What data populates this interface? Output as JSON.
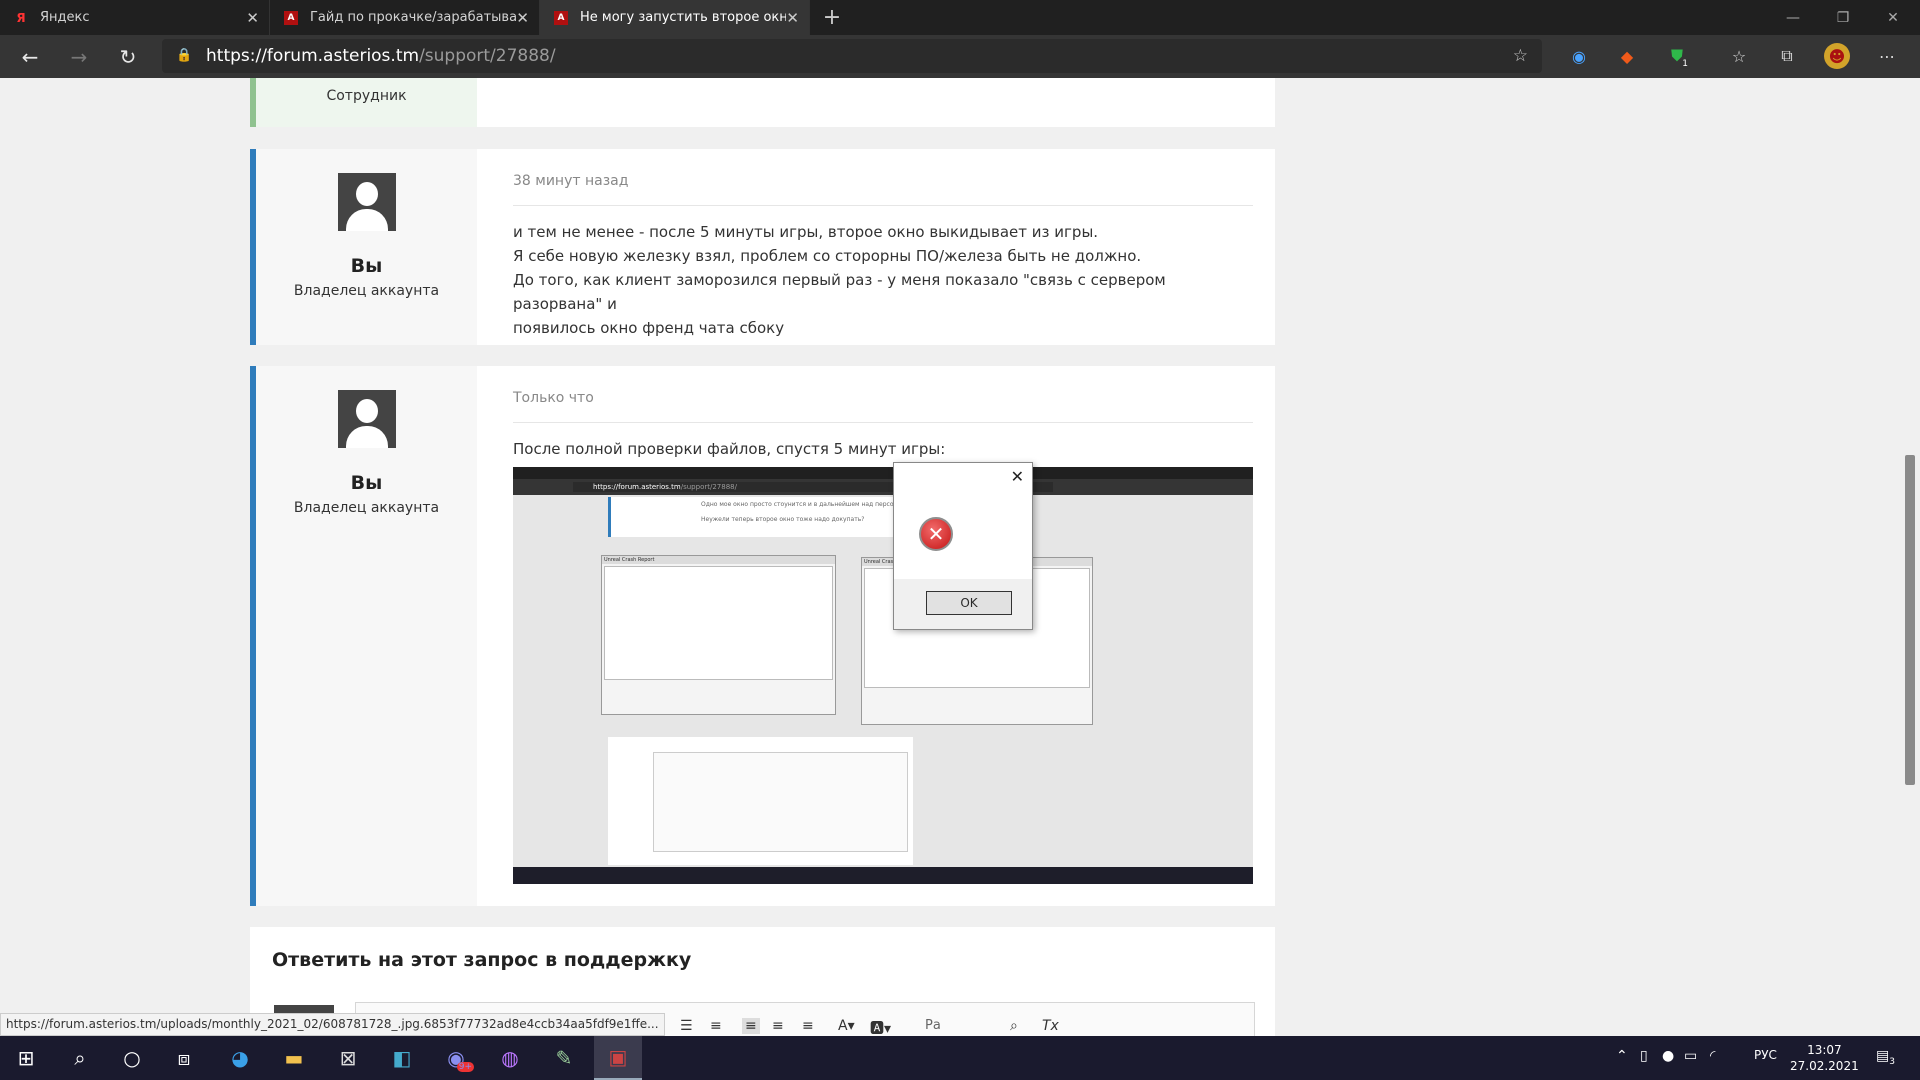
{
  "browser": {
    "tabs": [
      {
        "title": "Яндекс",
        "favicon": "Я"
      },
      {
        "title": "Гайд по прокачке/зарабатыван",
        "favicon": "A"
      },
      {
        "title": "Не могу запустить второе окно",
        "favicon": "A"
      }
    ],
    "url_host": "https://forum.asterios.tm",
    "url_path": "/support/27888/",
    "extension_badge": "1"
  },
  "top_strip": {
    "role": "Сотрудник"
  },
  "posts": [
    {
      "time": "38 минут назад",
      "author": "Вы",
      "role": "Владелец аккаунта",
      "lines": [
        "и тем не менее - после 5 минуты игры, второе окно выкидывает из игры.",
        "Я себе новую железку взял, проблем со сторорны ПО/железа быть не должно.",
        "До того, как клиент заморозился первый раз - у меня показало \"связь с сервером разорвана\" и",
        "появилось окно френд чата сбоку"
      ]
    },
    {
      "time": "Только что",
      "author": "Вы",
      "role": "Владелец аккаунта",
      "lines": [
        "После полной проверки файлов, спустя 5 минут игры:"
      ]
    }
  ],
  "embedded_screenshot": {
    "url_host": "https://forum.asterios.tm",
    "url_path": "/support/27888/",
    "window_title_left": "Unreal Crash Report",
    "window_title_right": "Unreal Crash Report",
    "line1": "Одно мое окно просто стоунится и в дальнейшем над персо",
    "line2": "Неужели теперь второе окно тоже надо докупать?"
  },
  "error_dialog": {
    "ok_label": "OK"
  },
  "reply": {
    "heading": "Ответить на этот запрос в поддержку",
    "font_select": "Ра"
  },
  "status_url": "https://forum.asterios.tm/uploads/monthly_2021_02/608781728_.jpg.6853f77732ad8e4ccb34aa5fdf9e1ffe...",
  "taskbar": {
    "lang": "РУС",
    "time": "13:07",
    "date": "27.02.2021",
    "notification_count": "3",
    "discord_badge": "9+"
  }
}
